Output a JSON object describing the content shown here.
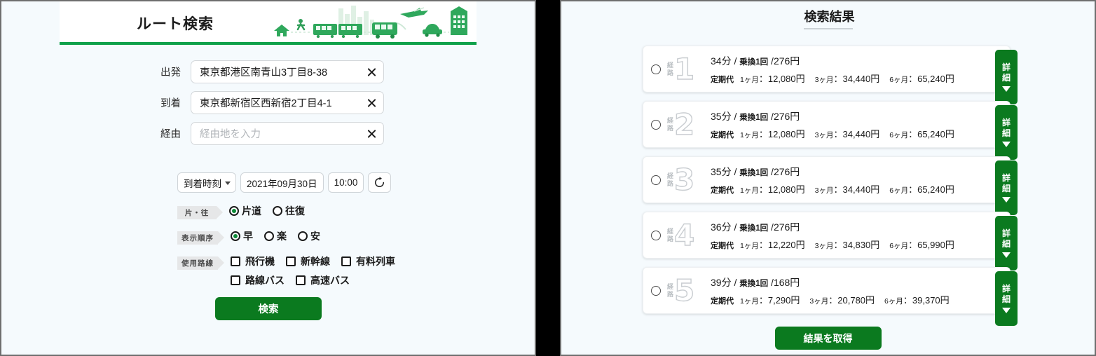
{
  "left": {
    "header": {
      "title": "ルート検索",
      "illustration": "city-transport-illustration"
    },
    "fields": [
      {
        "label": "出発",
        "value": "東京都港区南青山3丁目8-38",
        "placeholder": "",
        "clear": "clear-icon"
      },
      {
        "label": "到着",
        "value": "東京都新宿区西新宿2丁目4-1",
        "placeholder": "",
        "clear": "clear-icon"
      },
      {
        "label": "経由",
        "value": "",
        "placeholder": "経由地を入力",
        "clear": "clear-icon"
      }
    ],
    "datetime": {
      "mode": "到着時刻",
      "date": "2021年09月30日",
      "time": "10:00",
      "reload_icon": "reload-icon"
    },
    "options": [
      {
        "tag": "片・往",
        "type": "radio",
        "items": [
          {
            "label": "片道",
            "selected": true
          },
          {
            "label": "往復",
            "selected": false
          }
        ]
      },
      {
        "tag": "表示順序",
        "type": "radio",
        "items": [
          {
            "label": "早",
            "selected": true
          },
          {
            "label": "楽",
            "selected": false
          },
          {
            "label": "安",
            "selected": false
          }
        ]
      },
      {
        "tag": "使用路線",
        "type": "checkbox",
        "items": [
          {
            "label": "飛行機",
            "checked": false
          },
          {
            "label": "新幹線",
            "checked": false
          },
          {
            "label": "有料列車",
            "checked": false
          },
          {
            "label": "路線バス",
            "checked": false
          },
          {
            "label": "高速バス",
            "checked": false
          }
        ]
      }
    ],
    "search_button": "検索"
  },
  "right": {
    "title": "検索結果",
    "route_kanji_top": "経",
    "route_kanji_bottom": "路",
    "fare_label": "定期代",
    "detail_top": "詳",
    "detail_bottom": "細",
    "results": [
      {
        "number": "1",
        "duration": "34分",
        "transfers": "乗換1回",
        "fare": "276円",
        "pass": [
          {
            "term": "1ヶ月",
            "price": "12,080円"
          },
          {
            "term": "3ヶ月",
            "price": "34,440円"
          },
          {
            "term": "6ヶ月",
            "price": "65,240円"
          }
        ]
      },
      {
        "number": "2",
        "duration": "35分",
        "transfers": "乗換1回",
        "fare": "276円",
        "pass": [
          {
            "term": "1ヶ月",
            "price": "12,080円"
          },
          {
            "term": "3ヶ月",
            "price": "34,440円"
          },
          {
            "term": "6ヶ月",
            "price": "65,240円"
          }
        ]
      },
      {
        "number": "3",
        "duration": "35分",
        "transfers": "乗換1回",
        "fare": "276円",
        "pass": [
          {
            "term": "1ヶ月",
            "price": "12,080円"
          },
          {
            "term": "3ヶ月",
            "price": "34,440円"
          },
          {
            "term": "6ヶ月",
            "price": "65,240円"
          }
        ]
      },
      {
        "number": "4",
        "duration": "36分",
        "transfers": "乗換1回",
        "fare": "276円",
        "pass": [
          {
            "term": "1ヶ月",
            "price": "12,220円"
          },
          {
            "term": "3ヶ月",
            "price": "34,830円"
          },
          {
            "term": "6ヶ月",
            "price": "65,990円"
          }
        ]
      },
      {
        "number": "5",
        "duration": "39分",
        "transfers": "乗換1回",
        "fare": "168円",
        "pass": [
          {
            "term": "1ヶ月",
            "price": "7,290円"
          },
          {
            "term": "3ヶ月",
            "price": "20,780円"
          },
          {
            "term": "6ヶ月",
            "price": "39,370円"
          }
        ]
      }
    ],
    "fetch_button": "結果を取得"
  },
  "colors": {
    "accent_green": "#0b7a1f",
    "rule_green": "#10a14b",
    "panel_bg": "#f5fafd",
    "gap_black": "#000000"
  }
}
